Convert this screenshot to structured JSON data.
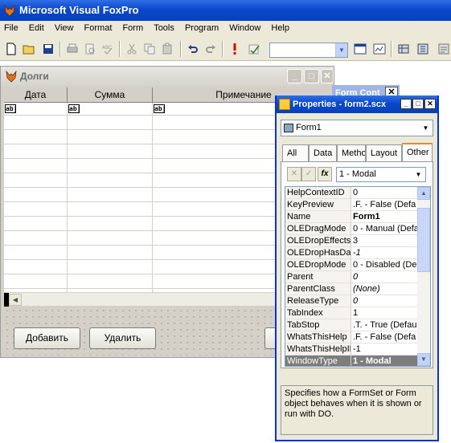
{
  "app": {
    "title": "Microsoft Visual FoxPro"
  },
  "menu": [
    "File",
    "Edit",
    "View",
    "Format",
    "Form",
    "Tools",
    "Program",
    "Window",
    "Help"
  ],
  "toolbar": {
    "icons": [
      "new-icon",
      "open-icon",
      "save-icon",
      "print-icon",
      "print-preview-icon",
      "spell-check-icon",
      "cut-icon",
      "copy-icon",
      "paste-icon",
      "undo-icon",
      "redo-icon",
      "run-icon",
      "modify-icon"
    ],
    "combo_value": ""
  },
  "form": {
    "title": "Долги",
    "columns": [
      "Дата",
      "Сумма",
      "Примечание"
    ],
    "cell_marker": "ab|",
    "buttons": {
      "add": "Добавить",
      "delete": "Удалить"
    }
  },
  "form_controls": {
    "title": "Form Cont"
  },
  "properties": {
    "title": "Properties - form2.scx",
    "object": "Form1",
    "tabs": [
      "All",
      "Data",
      "Metho",
      "Layout",
      "Other"
    ],
    "active_tab": "Other",
    "value_combo": "1 - Modal",
    "rows": [
      {
        "name": "HelpContextID",
        "value": "0"
      },
      {
        "name": "KeyPreview",
        "value": ".F. - False (Defa"
      },
      {
        "name": "Name",
        "value": "Form1"
      },
      {
        "name": "OLEDragMode",
        "value": "0 - Manual (Defa"
      },
      {
        "name": "OLEDropEffects",
        "value": "3"
      },
      {
        "name": "OLEDropHasData",
        "value": "-1"
      },
      {
        "name": "OLEDropMode",
        "value": "0 - Disabled (De"
      },
      {
        "name": "Parent",
        "value": "0"
      },
      {
        "name": "ParentClass",
        "value": "(None)"
      },
      {
        "name": "ReleaseType",
        "value": "0"
      },
      {
        "name": "TabIndex",
        "value": "1"
      },
      {
        "name": "TabStop",
        "value": ".T. - True (Defau"
      },
      {
        "name": "WhatsThisHelp",
        "value": ".F. - False (Defa"
      },
      {
        "name": "WhatsThisHelpID",
        "value": "-1"
      },
      {
        "name": "WindowType",
        "value": "1 - Modal"
      }
    ],
    "description": "Specifies how a FormSet or Form object behaves when it is shown or run with DO."
  }
}
